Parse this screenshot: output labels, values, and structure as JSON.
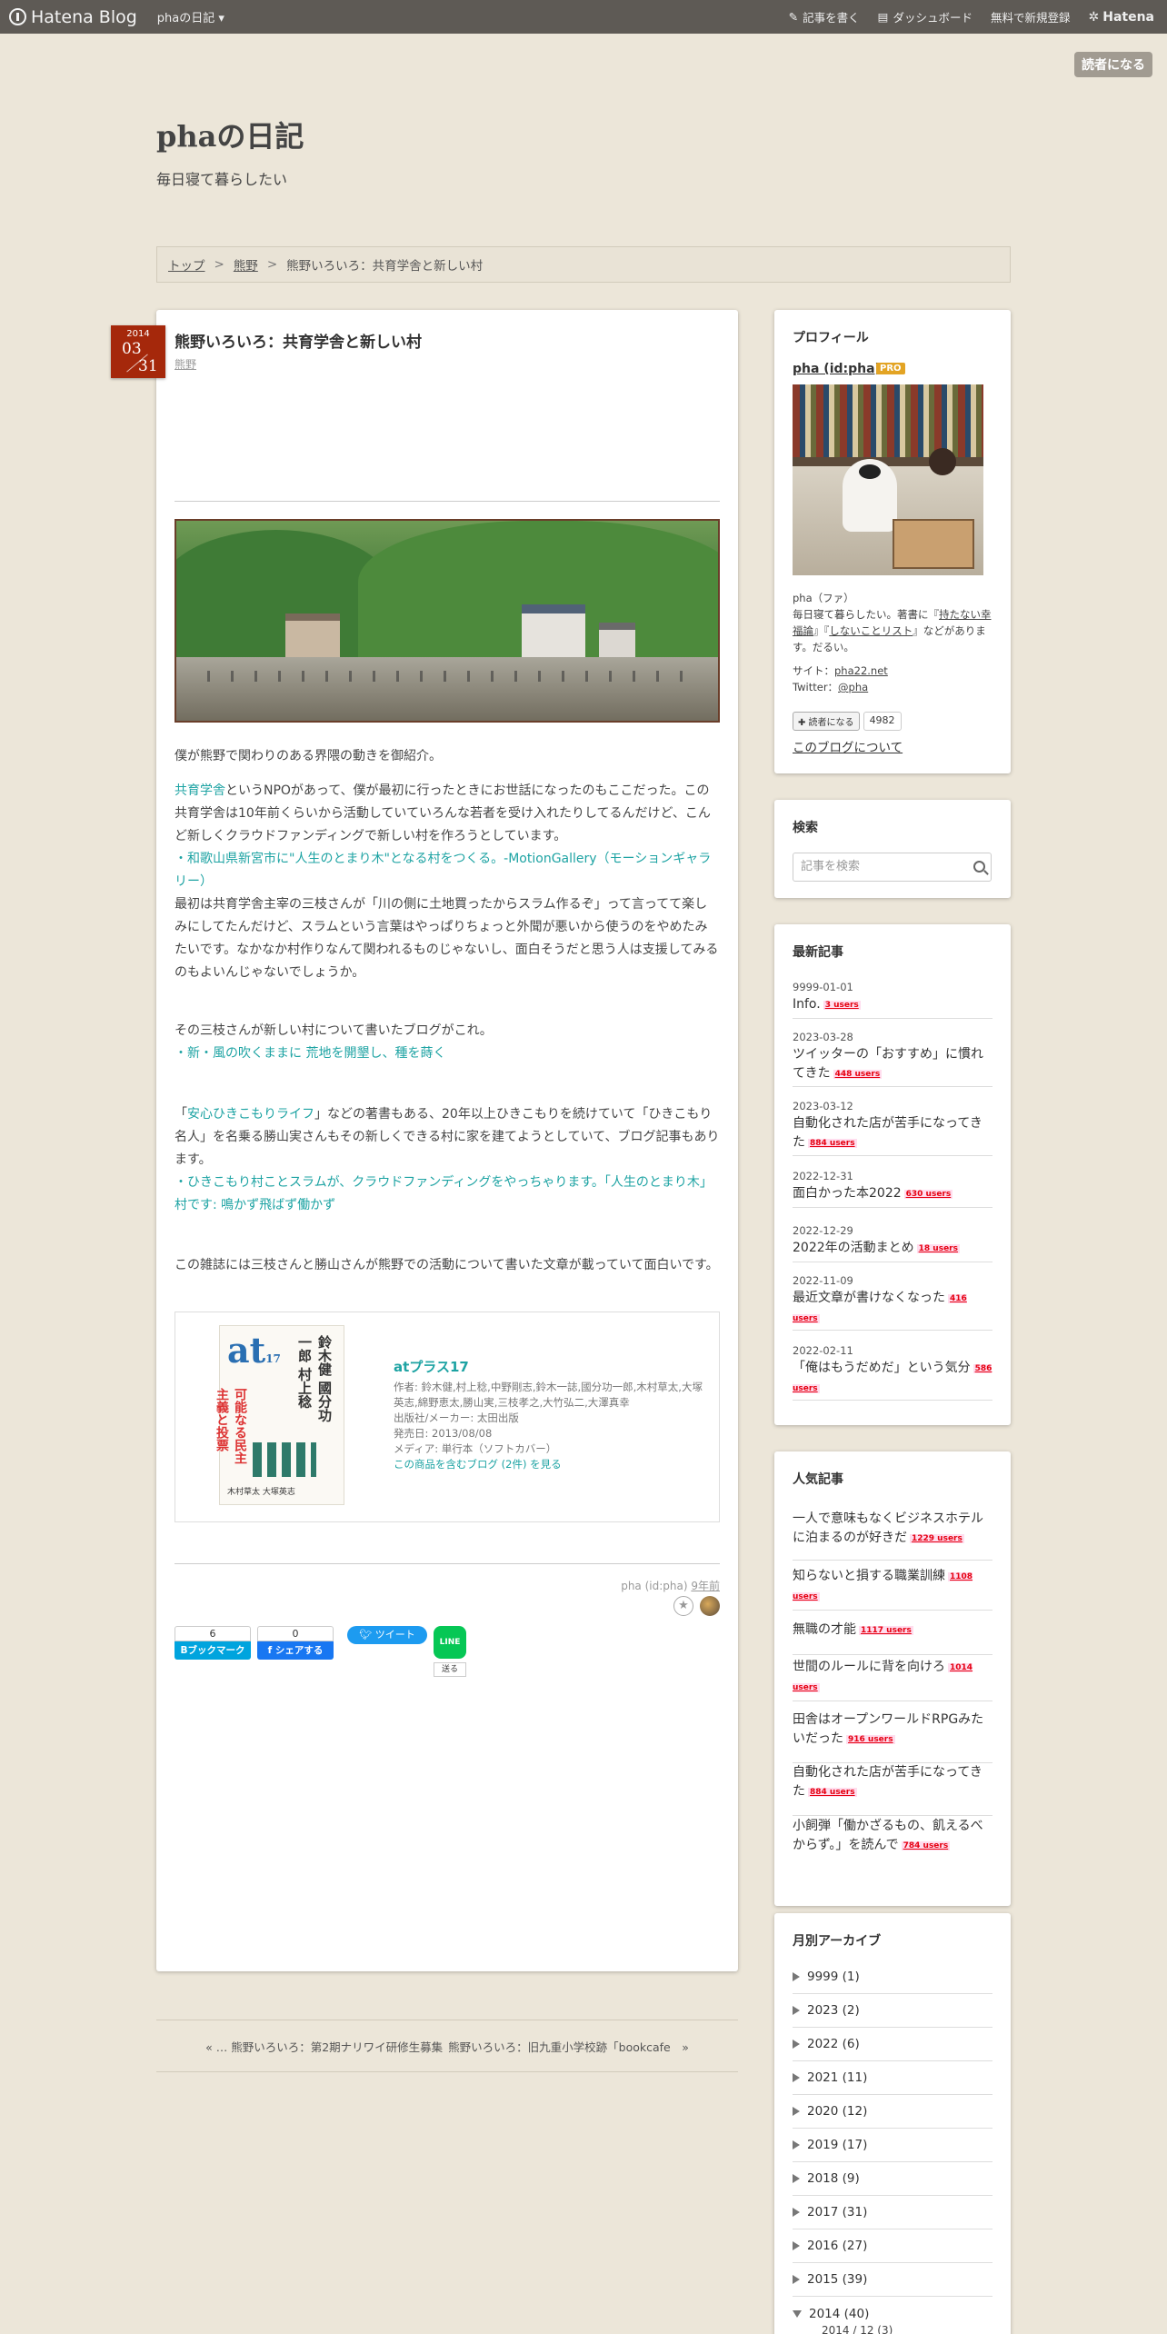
{
  "globalbar": {
    "logo": "Hatena Blog",
    "blog_menu": "phaの日記 ▾",
    "write": "記事を書く",
    "dashboard": "ダッシュボード",
    "signup": "無料で新規登録",
    "hatena": "Hatena"
  },
  "reader_button": "読者になる",
  "blog": {
    "title": "phaの日記",
    "description": "毎日寝て暮らしたい"
  },
  "breadcrumb": {
    "top": "トップ",
    "sep": ">",
    "category": "熊野",
    "current": "熊野いろいろ：共育学舎と新しい村"
  },
  "entry": {
    "date_year": "2014",
    "date_month": "03",
    "date_day": "31",
    "title": "熊野いろいろ：共育学舎と新しい村",
    "category": "熊野",
    "intro": "僕が熊野で関わりのある界隈の動きを御紹介。",
    "p1_link": "共育学舎",
    "p1_text": "というNPOがあって、僕が最初に行ったときにお世話になったのもここだった。この共育学舎は10年前くらいから活動していていろんな若者を受け入れたりしてるんだけど、こんど新しくクラウドファンディングで新しい村を作ろうとしています。",
    "p1_bullet": "・和歌山県新宮市に\"人生のとまり木\"となる村をつくる。-MotionGallery（モーションギャラリー）",
    "p1_after": "最初は共育学舎主宰の三枝さんが「川の側に土地買ったからスラム作るぞ」って言ってて楽しみにしてたんだけど、スラムという言葉はやっぱりちょっと外聞が悪いから使うのをやめたみたいです。なかなか村作りなんて関われるものじゃないし、面白そうだと思う人は支援してみるのもよいんじゃないでしょうか。",
    "p2_text": "その三枝さんが新しい村について書いたブログがこれ。",
    "p2_bullet": "・新・風の吹くままに 荒地を開墾し、種を蒔く",
    "p3_open": "「",
    "p3_link": "安心ひきこもりライフ",
    "p3_text": "」などの著書もある、20年以上ひきこもりを続けていて「ひきこもり名人」を名乗る勝山実さんもその新しくできる村に家を建てようとしていて、ブログ記事もあります。",
    "p3_bullet": "・ひきこもり村ことスラムが、クラウドファンディングをやっちゃります。「人生のとまり木」村です: 鳴かず飛ばず働かず",
    "p4_text": "この雑誌には三枝さんと勝山さんが熊野での活動について書いた文章が載っていて面白いです。",
    "author": "pha (id:pha)",
    "ago": "9年前"
  },
  "product": {
    "title": "atプラス17",
    "authors": "作者: 鈴木健,村上稔,中野剛志,鈴木一誌,國分功一郎,木村草太,大塚英志,綿野恵太,勝山実,三枝孝之,大竹弘二,大澤真幸",
    "publisher": "出版社/メーカー: 太田出版",
    "release": "発売日: 2013/08/08",
    "media": "メディア: 単行本（ソフトカバー）",
    "blogs_link": "この商品を含むブログ (2件) を見る",
    "cover_logo": "at",
    "cover_issue": "17",
    "cover_names": "鈴木健 國分功一郎 村上稔",
    "cover_red": "可能なる民主主義と投票",
    "cover_bottom": "木村草太 大塚英志"
  },
  "share": {
    "hatebu_count": "6",
    "hatebu_label": "Bブックマーク",
    "fb_count": "0",
    "fb_label": "f シェアする",
    "tweet_label": "ツイート",
    "line_label": "LINE",
    "line_send": "送る"
  },
  "pager": {
    "prev": "« … 熊野いろいろ：第2期ナリワイ研修生募集",
    "next": "熊野いろいろ：旧九重小学校跡「bookcafe　»"
  },
  "profile": {
    "heading": "プロフィール",
    "name": "pha (id:pha)",
    "badge": "PRO",
    "line1": "pha（ファ）",
    "line2_pre": "毎日寝て暮らしたい。著書に『",
    "book1": "持たない幸福論",
    "line2_mid": "』『",
    "book2": "しないことリスト",
    "line2_post": "』などがあります。だるい。",
    "site_label": "サイト：",
    "site": "pha22.net",
    "twitter_label": "Twitter：",
    "twitter": "@pha",
    "reader_btn": "✚ 読者になる",
    "reader_count": "4982",
    "about": "このブログについて"
  },
  "search": {
    "heading": "検索",
    "placeholder": "記事を検索"
  },
  "recent": {
    "heading": "最新記事",
    "items": [
      {
        "date": "9999-01-01",
        "title": "Info.",
        "users": "3 users"
      },
      {
        "date": "2023-03-28",
        "title": "ツイッターの「おすすめ」に慣れてきた",
        "users": "448 users"
      },
      {
        "date": "2023-03-12",
        "title": "自動化された店が苦手になってきた",
        "users": "884 users"
      },
      {
        "date": "2022-12-31",
        "title": "面白かった本2022",
        "users": "630 users"
      },
      {
        "date": "2022-12-29",
        "title": "2022年の活動まとめ",
        "users": "18 users"
      },
      {
        "date": "2022-11-09",
        "title": "最近文章が書けなくなった",
        "users": "416 users"
      },
      {
        "date": "2022-02-11",
        "title": "「俺はもうだめだ」という気分",
        "users": "586 users"
      }
    ]
  },
  "popular": {
    "heading": "人気記事",
    "items": [
      {
        "title": "一人で意味もなくビジネスホテルに泊まるのが好きだ",
        "users": "1229 users"
      },
      {
        "title": "知らないと損する職業訓練",
        "users": "1108 users"
      },
      {
        "title": "無職の才能",
        "users": "1117 users"
      },
      {
        "title": "世間のルールに背を向けろ",
        "users": "1014 users"
      },
      {
        "title": "田舎はオープンワールドRPGみたいだった",
        "users": "916 users"
      },
      {
        "title": "自動化された店が苦手になってきた",
        "users": "884 users"
      },
      {
        "title": "小飼弾「働かざるもの、飢えるべからず。」を読んで",
        "users": "784 users"
      }
    ]
  },
  "archive": {
    "heading": "月別アーカイブ",
    "items": [
      "9999 (1)",
      "2023 (2)",
      "2022 (6)",
      "2021 (11)",
      "2020 (12)",
      "2019 (17)",
      "2018 (9)",
      "2017 (31)",
      "2016 (27)",
      "2015 (39)",
      "2014 (40)"
    ],
    "sub_item": "2014 / 12 (3)"
  }
}
